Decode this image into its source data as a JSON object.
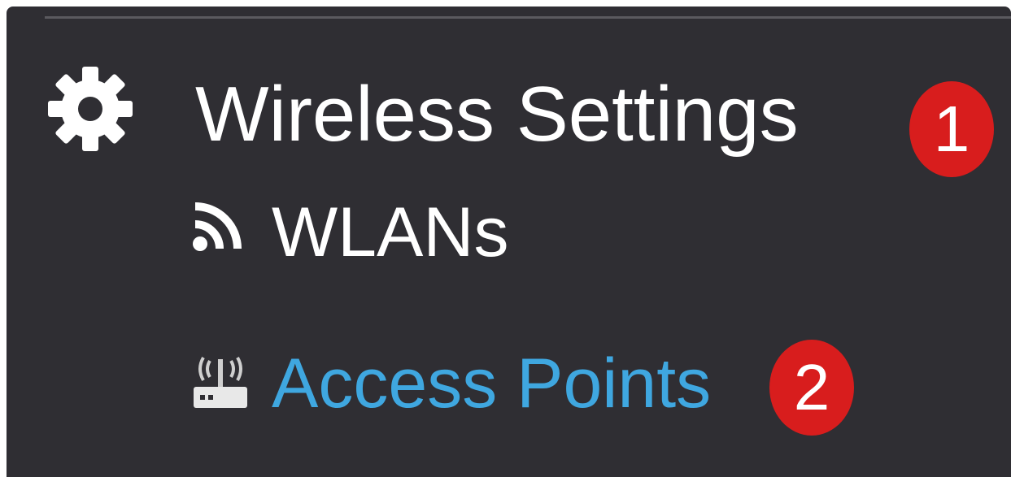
{
  "sidebar": {
    "section": {
      "icon": "gear-icon",
      "title": "Wireless Settings",
      "step_badge": "1"
    },
    "items": [
      {
        "icon": "wifi-icon",
        "label": "WLANs"
      },
      {
        "icon": "access-point-icon",
        "label": "Access Points",
        "step_badge": "2"
      }
    ]
  },
  "colors": {
    "panel_background": "#2f2e33",
    "text": "#ffffff",
    "link": "#3fa7e0",
    "badge": "#d81d1d"
  }
}
